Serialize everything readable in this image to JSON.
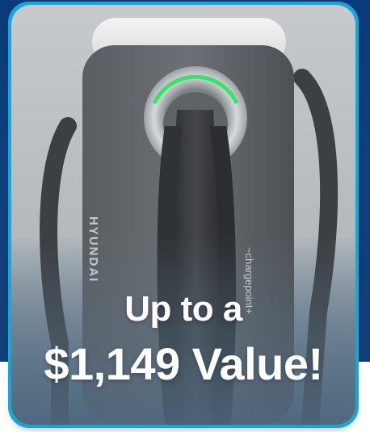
{
  "promo": {
    "headline_line1": "Up to a",
    "headline_line2": "$1,149 Value!"
  },
  "product": {
    "brand_logo_text": "HYUNDAI",
    "partner_logo_text": "~chargepoint+"
  },
  "colors": {
    "background_top": "#0f3f7e",
    "card_border": "#1aa6d5",
    "indicator_light": "#39e36a"
  }
}
